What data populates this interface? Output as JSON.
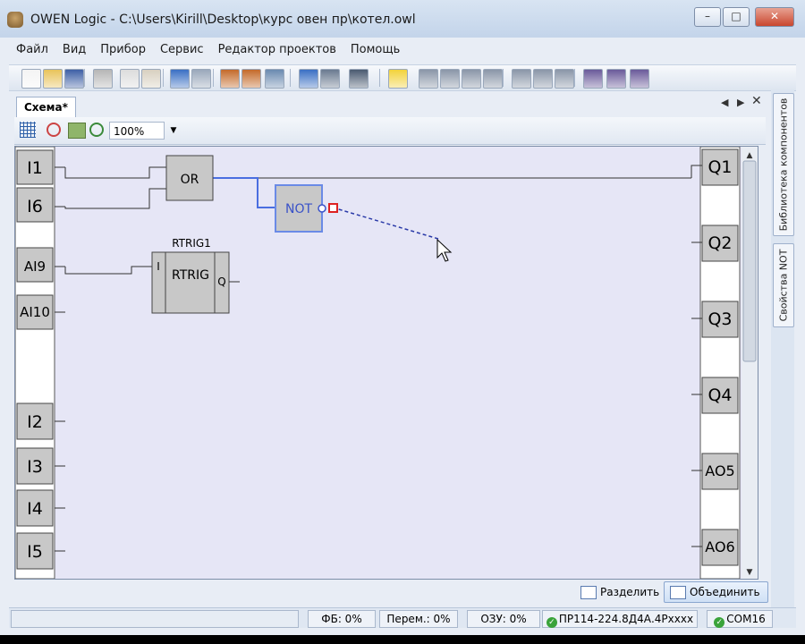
{
  "window": {
    "title": "OWEN Logic - C:\\Users\\Kirill\\Desktop\\курс овен пр\\котел.owl"
  },
  "menu": [
    "Файл",
    "Вид",
    "Прибор",
    "Сервис",
    "Редактор проектов",
    "Помощь"
  ],
  "toolbar": {
    "icons": [
      "new-icon",
      "open-icon",
      "save-icon",
      "print-icon",
      "copy-icon",
      "paste-icon",
      "undo-icon",
      "redo-icon",
      "tool-icon",
      "tool-icon",
      "table-icon",
      "play-icon",
      "download-icon",
      "grid-icon",
      "text-icon",
      "var-icon",
      "var-icon",
      "var-icon",
      "var-icon",
      "net-icon",
      "net-icon",
      "net-icon",
      "bool-icon",
      "bool-icon",
      "bool-icon"
    ]
  },
  "tabs": {
    "schema": "Схема*"
  },
  "zoom": {
    "value": "100%"
  },
  "inputs": [
    "I1",
    "I6",
    "AI9",
    "AI10",
    "I2",
    "I3",
    "I4",
    "I5"
  ],
  "outputs": [
    "Q1",
    "Q2",
    "Q3",
    "Q4",
    "AO5",
    "AO6"
  ],
  "blocks": {
    "or": {
      "label": "OR"
    },
    "not": {
      "label": "NOT"
    },
    "rtrig": {
      "title": "RTRIG1",
      "label": "RTRIG",
      "pin_in": "I",
      "pin_out": "Q"
    }
  },
  "right_panel": {
    "library": "Библиотека компонентов",
    "properties": "Свойства NOT"
  },
  "bottom": {
    "split": "Разделить",
    "merge": "Объединить"
  },
  "status": {
    "fb": "ФБ: 0%",
    "vars": "Перем.: 0%",
    "ram": "ОЗУ: 0%",
    "device": "ПР114-224.8Д4А.4Pxxxx",
    "port": "COM16"
  },
  "colors": {
    "canvas": "#e6e6f6",
    "wire": "#333333",
    "selected": "#4a6ee0",
    "block": "#c8c8c8"
  }
}
